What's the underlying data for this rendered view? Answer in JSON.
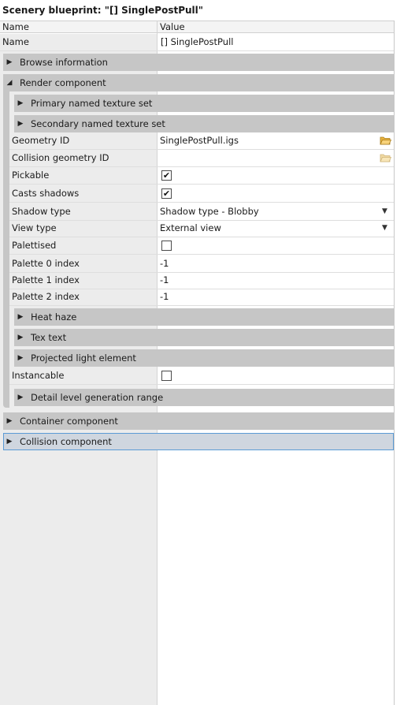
{
  "window": {
    "title": "Scenery blueprint: \"[] SinglePostPull\""
  },
  "columns": {
    "name": "Name",
    "value": "Value"
  },
  "top_row": {
    "label": "Name",
    "value": "[] SinglePostPull"
  },
  "groups": {
    "browse": "Browse information",
    "render": "Render component",
    "primary_texture": "Primary named texture set",
    "secondary_texture": "Secondary named texture set",
    "heat_haze": "Heat haze",
    "tex_text": "Tex text",
    "projected_light": "Projected light element",
    "detail_level": "Detail level generation range",
    "container": "Container component",
    "collision": "Collision component"
  },
  "render_props": {
    "geometry_id": {
      "label": "Geometry ID",
      "value": "SinglePostPull.igs"
    },
    "collision_geometry_id": {
      "label": "Collision geometry ID",
      "value": ""
    },
    "pickable": {
      "label": "Pickable",
      "checked": true
    },
    "casts_shadows": {
      "label": "Casts shadows",
      "checked": true
    },
    "shadow_type": {
      "label": "Shadow type",
      "value": "Shadow type - Blobby"
    },
    "view_type": {
      "label": "View type",
      "value": "External view"
    },
    "palettised": {
      "label": "Palettised",
      "checked": false
    },
    "palette0": {
      "label": "Palette 0 index",
      "value": "-1"
    },
    "palette1": {
      "label": "Palette 1 index",
      "value": "-1"
    },
    "palette2": {
      "label": "Palette 2 index",
      "value": "-1"
    },
    "instancable": {
      "label": "Instancable",
      "checked": false
    }
  },
  "glyphs": {
    "collapsed": "▶",
    "expanded": "◢",
    "dropdown": "▼",
    "check": "✔"
  },
  "colors": {
    "group_bg": "#c6c6c6",
    "selection_border": "#5b9bd5",
    "left_column_bg": "#ececec",
    "folder": "#f2c14e"
  }
}
